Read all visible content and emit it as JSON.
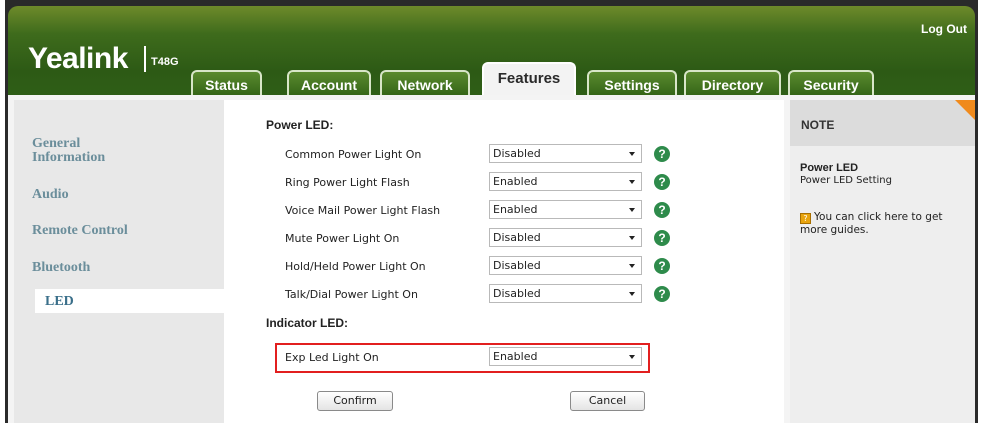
{
  "brand": {
    "logo": "Yealink",
    "model": "T48G"
  },
  "header": {
    "logout_label": "Log Out"
  },
  "tabs": [
    {
      "label": "Status",
      "active": false
    },
    {
      "label": "Account",
      "active": false
    },
    {
      "label": "Network",
      "active": false
    },
    {
      "label": "Features",
      "active": true
    },
    {
      "label": "Settings",
      "active": false
    },
    {
      "label": "Directory",
      "active": false
    },
    {
      "label": "Security",
      "active": false
    }
  ],
  "sidebar": {
    "items": [
      {
        "label": "General\nInformation",
        "active": false
      },
      {
        "label": "Audio",
        "active": false
      },
      {
        "label": "Remote Control",
        "active": false
      },
      {
        "label": "Bluetooth",
        "active": false
      },
      {
        "label": "LED",
        "active": true
      }
    ]
  },
  "main": {
    "power_led": {
      "title": "Power LED:",
      "rows": [
        {
          "label": "Common Power Light On",
          "value": "Disabled"
        },
        {
          "label": "Ring Power Light Flash",
          "value": "Enabled"
        },
        {
          "label": "Voice Mail Power Light Flash",
          "value": "Enabled"
        },
        {
          "label": "Mute Power Light On",
          "value": "Disabled"
        },
        {
          "label": "Hold/Held Power Light On",
          "value": "Disabled"
        },
        {
          "label": "Talk/Dial Power Light On",
          "value": "Disabled"
        }
      ]
    },
    "indicator_led": {
      "title": "Indicator LED:",
      "rows": [
        {
          "label": "Exp Led Light On",
          "value": "Enabled"
        }
      ]
    },
    "help_glyph": "?",
    "confirm_label": "Confirm",
    "cancel_label": "Cancel"
  },
  "note": {
    "title": "NOTE",
    "heading": "Power LED",
    "subheading": "Power LED Setting",
    "guide_icon_glyph": "?",
    "guide_text": "You can click here to get more guides."
  },
  "colors": {
    "header_green": "#2d5a15",
    "sidebar_link": "#6b8e9b",
    "highlight_red": "#e21f1f",
    "note_corner": "#f08a1c",
    "help_green": "#2e8b4b"
  }
}
